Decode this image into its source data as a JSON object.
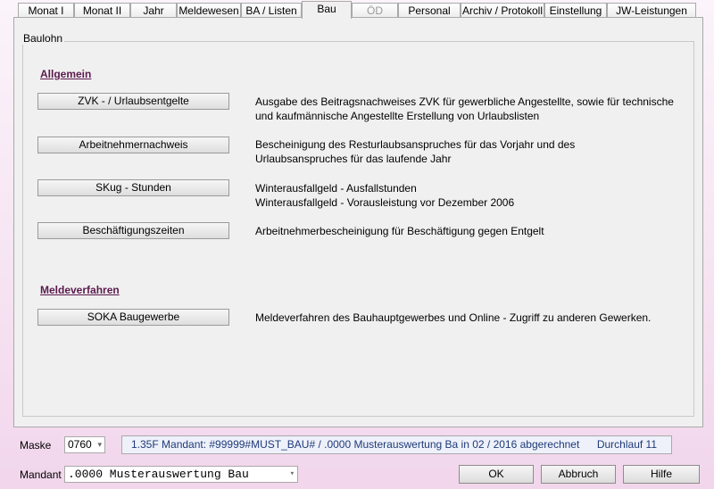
{
  "tabs": [
    {
      "label": "Monat I",
      "state": "normal"
    },
    {
      "label": "Monat II",
      "state": "normal"
    },
    {
      "label": "Jahr",
      "state": "normal"
    },
    {
      "label": "Meldewesen",
      "state": "normal"
    },
    {
      "label": "BA / Listen",
      "state": "normal"
    },
    {
      "label": "Bau",
      "state": "active"
    },
    {
      "label": "ÖD",
      "state": "disabled"
    },
    {
      "label": "Personal",
      "state": "normal"
    },
    {
      "label": "Archiv / Protokoll",
      "state": "normal"
    },
    {
      "label": "Einstellung",
      "state": "normal"
    },
    {
      "label": "JW-Leistungen",
      "state": "normal"
    }
  ],
  "group": {
    "legend": "Baulohn"
  },
  "sections": {
    "allgemein": "Allgemein",
    "meldeverfahren": "Meldeverfahren"
  },
  "actions": [
    {
      "label": "ZVK - / Urlaubsentgelte",
      "desc1": "Ausgabe des Beitragsnachweises ZVK für gewerbliche Angestellte, sowie für technische",
      "desc2": "und kaufmännische Angestellte Erstellung von Urlaubslisten"
    },
    {
      "label": "Arbeitnehmernachweis",
      "desc1": "Bescheinigung des Resturlaubsanspruches für das Vorjahr und des",
      "desc2": "Urlaubsanspruches für das laufende Jahr"
    },
    {
      "label": "SKug - Stunden",
      "desc1": "Winterausfallgeld - Ausfallstunden",
      "desc2": "Winterausfallgeld - Vorausleistung vor Dezember 2006"
    },
    {
      "label": "Beschäftigungszeiten",
      "desc1": "Arbeitnehmerbescheinigung für Beschäftigung gegen Entgelt",
      "desc2": ""
    },
    {
      "label": "SOKA Baugewerbe",
      "desc1": "Meldeverfahren des Bauhauptgewerbes und Online - Zugriff zu anderen Gewerken.",
      "desc2": ""
    }
  ],
  "footer": {
    "maske_label": "Maske",
    "maske_value": "0760",
    "status_text": "1.35F Mandant: #99999#MUST_BAU# / .0000 Musterauswertung Ba in 02 / 2016 abgerechnet",
    "run_text": "Durchlauf 11",
    "mandant_label": "Mandant",
    "mandant_value": ".0000 Musterauswertung Bau",
    "ok_label": "OK",
    "cancel_label": "Abbruch",
    "help_label": "Hilfe"
  },
  "icons": {
    "dropdown": "chevron-down-icon"
  },
  "colors": {
    "section_title": "#5b1a4d",
    "status_text": "#1e3a78",
    "background": "#f6e4f2"
  }
}
